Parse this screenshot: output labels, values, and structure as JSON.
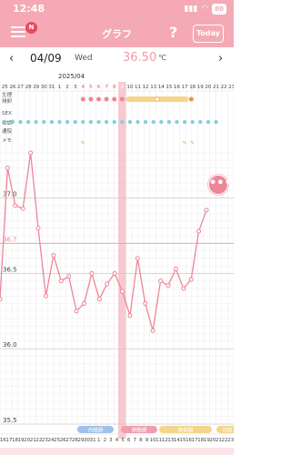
{
  "status": {
    "time": "12:48",
    "location_icon": "location-arrow-icon",
    "battery": "80"
  },
  "header": {
    "title": "グラフ",
    "badge": "N",
    "help": "?",
    "today": "Today"
  },
  "date_bar": {
    "date": "04/09",
    "day": "Wed",
    "temperature": "36.50",
    "unit": "℃",
    "prev": "‹",
    "next": "›"
  },
  "colors": {
    "accent": "#f4a9b4",
    "line": "#ee8597",
    "highlight": "#f4b3bd",
    "cyan": "#7fd3d6",
    "yellow": "#f5d58a",
    "blue": "#9fc1ea"
  },
  "chart_data": {
    "type": "line",
    "month_label": "2025/04",
    "top_days": [
      "25",
      "26",
      "27",
      "28",
      "29",
      "30",
      "31",
      "1",
      "2",
      "3",
      "4",
      "5",
      "6",
      "7",
      "8",
      "9",
      "10",
      "11",
      "12",
      "13",
      "14",
      "15",
      "16",
      "17",
      "18",
      "19",
      "20",
      "21",
      "22",
      "23"
    ],
    "bottom_days": [
      "16",
      "17",
      "18",
      "19",
      "20",
      "21",
      "22",
      "23",
      "24",
      "25",
      "26",
      "27",
      "28",
      "29",
      "30",
      "31",
      "1",
      "2",
      "3",
      "4",
      "5",
      "6",
      "7",
      "8",
      "9",
      "10",
      "11",
      "12",
      "13",
      "14",
      "15",
      "16",
      "17",
      "18",
      "19",
      "20",
      "21",
      "22",
      "23"
    ],
    "row_labels": [
      "生理",
      "排卵",
      "SEX",
      "体調",
      "通院",
      "メモ"
    ],
    "y_ticks": [
      "37.0",
      "36.7",
      "36.5",
      "36.0",
      "35.5"
    ],
    "ylim": [
      35.5,
      37.3
    ],
    "reference_line": 36.7,
    "values": [
      36.33,
      37.2,
      36.95,
      36.93,
      37.3,
      36.8,
      36.35,
      36.62,
      36.45,
      36.48,
      36.25,
      36.3,
      36.5,
      36.33,
      36.43,
      36.5,
      36.38,
      36.22,
      36.6,
      36.3,
      36.12,
      36.45,
      36.42,
      36.53,
      36.4,
      36.46,
      36.78,
      36.92
    ],
    "phases": [
      "月経期",
      "卵胞期",
      "黄体期",
      "月経"
    ],
    "highlight_date": "9"
  }
}
